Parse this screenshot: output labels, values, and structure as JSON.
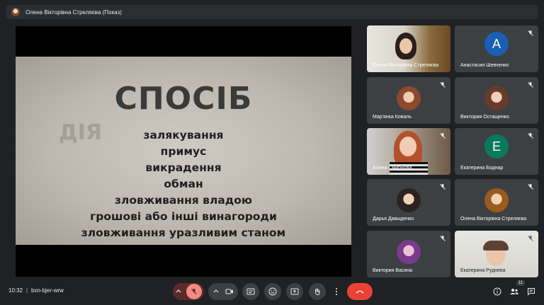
{
  "topbar": {
    "title": "Олена Вікторівна Стреляєва (Показ)"
  },
  "slide": {
    "heading": "СПОСІБ",
    "side_word": "ДІЯ",
    "lines": [
      "залякування",
      "примус",
      "викрадення",
      "обман",
      "зловживання владою",
      "грошові або інші винагороди",
      "зловживання уразливим станом"
    ]
  },
  "participants": [
    {
      "name": "Олена Вікторівна Стреляєва",
      "type": "video",
      "muted": false
    },
    {
      "name": "Анастасия Шевченко",
      "type": "letter",
      "letter": "А",
      "color": "#1a5fb4",
      "muted": true
    },
    {
      "name": "Мар'янка Коваль",
      "type": "photo",
      "muted": true
    },
    {
      "name": "Виктория Остащенко",
      "type": "photo",
      "muted": true
    },
    {
      "name": "Алина Смирнова",
      "type": "video",
      "muted": true
    },
    {
      "name": "Екатерина Боднар",
      "type": "letter",
      "letter": "Е",
      "color": "#0b7a5c",
      "muted": true
    },
    {
      "name": "Дарья Давыденко",
      "type": "photo",
      "muted": true
    },
    {
      "name": "Олена Вікторівна Стреляєва",
      "type": "photo",
      "muted": true
    },
    {
      "name": "Виктория Васина",
      "type": "photo",
      "muted": true
    },
    {
      "name": "Екатерина Руднева",
      "type": "video",
      "muted": true
    }
  ],
  "bottombar": {
    "time": "10:32",
    "separator": "|",
    "meeting_code": "bxn-bjer-wrw",
    "participant_count": "11"
  },
  "colors": {
    "end_call": "#ea4335",
    "mic_off": "#f28b82"
  }
}
